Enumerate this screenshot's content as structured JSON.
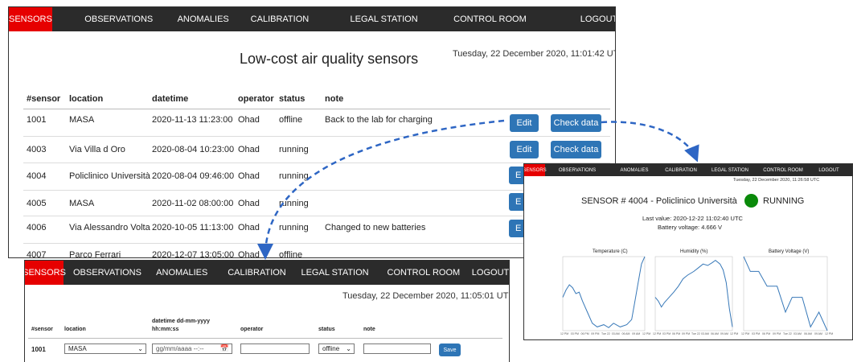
{
  "main": {
    "nav": [
      "SENSORS",
      "OBSERVATIONS",
      "ANOMALIES",
      "CALIBRATION",
      "LEGAL STATION",
      "CONTROL ROOM",
      "LOGOUT"
    ],
    "title": "Low-cost air quality sensors",
    "timestamp": "Tuesday, 22 December 2020, 11:01:42 UTC",
    "columns": [
      "#sensor",
      "location",
      "datetime",
      "operator",
      "status",
      "note"
    ],
    "rows": [
      {
        "sensor": "1001",
        "location": "MASA",
        "datetime": "2020-11-13 11:23:00",
        "operator": "Ohad",
        "status": "offline",
        "note": "Back to the lab for charging"
      },
      {
        "sensor": "4003",
        "location": "Via Villa d Oro",
        "datetime": "2020-08-04 10:23:00",
        "operator": "Ohad",
        "status": "running",
        "note": ""
      },
      {
        "sensor": "4004",
        "location": "Policlinico Università",
        "datetime": "2020-08-04 09:46:00",
        "operator": "Ohad",
        "status": "running",
        "note": ""
      },
      {
        "sensor": "4005",
        "location": "MASA",
        "datetime": "2020-11-02 08:00:00",
        "operator": "Ohad",
        "status": "running",
        "note": ""
      },
      {
        "sensor": "4006",
        "location": "Via Alessandro Volta",
        "datetime": "2020-10-05 11:13:00",
        "operator": "Ohad",
        "status": "running",
        "note": "Changed to new batteries"
      },
      {
        "sensor": "4007",
        "location": "Parco Ferrari",
        "datetime": "2020-12-07 13:05:00",
        "operator": "Ohad",
        "status": "offline",
        "note": ""
      }
    ],
    "edit_label": "Edit",
    "check_label": "Check data",
    "edit_partial": "E"
  },
  "edit_form": {
    "nav": [
      "SENSORS",
      "OBSERVATIONS",
      "ANOMALIES",
      "CALIBRATION",
      "LEGAL STATION",
      "CONTROL ROOM",
      "LOGOUT"
    ],
    "timestamp": "Tuesday, 22 December 2020, 11:05:01 UTC",
    "columns": {
      "sensor": "#sensor",
      "location": "location",
      "datetime_line1": "datetime dd-mm-yyyy",
      "datetime_line2": "hh:mm:ss",
      "operator": "operator",
      "status": "status",
      "note": "note"
    },
    "row": {
      "sensor": "1001",
      "location": "MASA",
      "datetime_placeholder": "gg/mm/aaaa --:--",
      "operator": "",
      "status": "offline",
      "note": ""
    },
    "save_label": "Save"
  },
  "sensor_detail": {
    "nav": [
      "SENSORS",
      "OBSERVATIONS",
      "ANOMALIES",
      "CALIBRATION",
      "LEGAL STATION",
      "CONTROL ROOM",
      "LOGOUT"
    ],
    "timestamp": "Tuesday, 22 December 2020, 11:26:58 UTC",
    "title": "SENSOR # 4004 - Policlinico Università",
    "status": "RUNNING",
    "status_color": "#0a8a0a",
    "last_value": "Last value: 2020-12-22 11:02:40 UTC",
    "battery": "Battery voltage: 4.666 V",
    "charts": [
      "Temperature (C)",
      "Humidity (%)",
      "Battery Voltage (V)"
    ],
    "x_ticks": [
      "12 PM",
      "03 PM",
      "06 PM",
      "09 PM",
      "Tue 22",
      "03 AM",
      "06 AM",
      "09 AM",
      "12 PM"
    ]
  },
  "colors": {
    "active_nav": "#e60000",
    "button": "#2e75b6",
    "arrow": "#2e66c4",
    "line": "#3778b8"
  }
}
